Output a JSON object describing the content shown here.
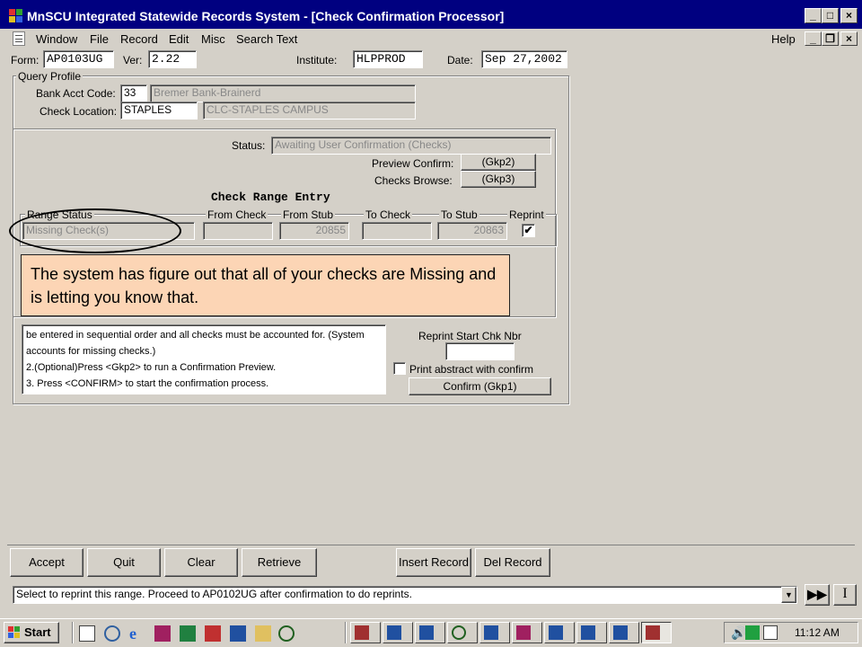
{
  "window": {
    "title": "MnSCU Integrated Statewide Records System - [Check Confirmation Processor]"
  },
  "menu": {
    "items": [
      "Window",
      "File",
      "Record",
      "Edit",
      "Misc",
      "Search Text"
    ],
    "help": "Help"
  },
  "header": {
    "form_label": "Form:",
    "form_value": "AP0103UG",
    "ver_label": "Ver:",
    "ver_value": "2.22",
    "institute_label": "Institute:",
    "institute_value": "HLPPROD",
    "date_label": "Date:",
    "date_value": "Sep 27,2002"
  },
  "query_profile": {
    "title": "Query Profile",
    "bank_label": "Bank Acct Code:",
    "bank_code": "33",
    "bank_name": "Bremer Bank-Brainerd",
    "location_label": "Check Location:",
    "location_code": "STAPLES",
    "location_name": "CLC-STAPLES CAMPUS"
  },
  "status": {
    "label": "Status:",
    "value": "Awaiting User Confirmation (Checks)",
    "preview_label": "Preview Confirm:",
    "preview_button": "(Gkp2)",
    "browse_label": "Checks Browse:",
    "browse_button": "(Gkp3)"
  },
  "range_entry": {
    "title": "Check Range Entry",
    "headers": [
      "Range Status",
      "From Check",
      "From Stub",
      "To Check",
      "To Stub",
      "Reprint"
    ],
    "row": {
      "range_status": "Missing Check(s)",
      "from_check": "",
      "from_stub": "20855",
      "to_check": "",
      "to_stub": "20863",
      "reprint_checked": true
    }
  },
  "callout": {
    "text": "The system has figure out that all of your checks are Missing and is letting you know that."
  },
  "instructions": {
    "lines": [
      "be entered in sequential order and all checks must be accounted for. (System",
      "accounts for missing checks.)",
      "2.(Optional)Press <Gkp2> to run a Confirmation Preview.",
      "3. Press <CONFIRM> to start the confirmation process."
    ]
  },
  "confirm_panel": {
    "reprint_label": "Reprint Start Chk Nbr",
    "reprint_value": "",
    "abstract_label": "Print abstract with confirm",
    "abstract_checked": false,
    "confirm_button": "Confirm (Gkp1)"
  },
  "bottom_buttons": [
    "Accept",
    "Quit",
    "Clear",
    "Retrieve",
    "Insert Record",
    "Del Record"
  ],
  "message": {
    "text": "Select to reprint this range. Proceed to AP0102UG after confirmation to do reprints."
  },
  "taskbar": {
    "start": "Start",
    "clock": "11:12 AM"
  }
}
